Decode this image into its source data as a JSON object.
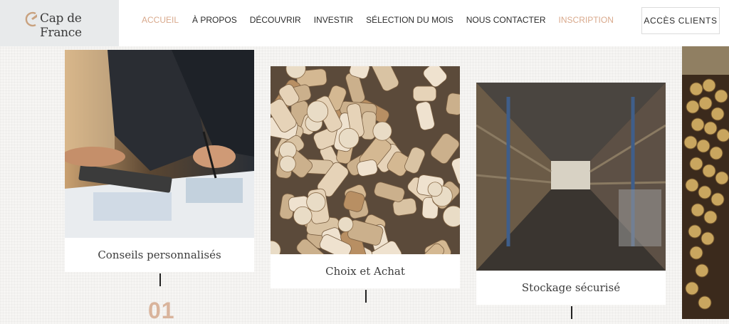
{
  "header": {
    "logo_text": "Cap de France",
    "nav": [
      {
        "label": "ACCUEIL",
        "accent": true
      },
      {
        "label": "À PROPOS",
        "accent": false
      },
      {
        "label": "DÉCOUVRIR",
        "accent": false
      },
      {
        "label": "INVESTIR",
        "accent": false
      },
      {
        "label": "SÉLECTION DU MOIS",
        "accent": false
      },
      {
        "label": "NOUS CONTACTER",
        "accent": false
      },
      {
        "label": "INSCRIPTION",
        "accent": true
      }
    ],
    "clients_button": "ACCÈS CLIENTS"
  },
  "cards": [
    {
      "caption": "Conseils personnalisés",
      "step": "01"
    },
    {
      "caption": "Choix et Achat"
    },
    {
      "caption": "Stockage sécurisé"
    }
  ],
  "colors": {
    "accent": "#d9a98c",
    "logo_bg": "#e8eaeb",
    "text": "#2b2b2b",
    "step_number": "#d9b49c"
  },
  "icons": {
    "logo": "cap-de-france-logo-icon"
  }
}
